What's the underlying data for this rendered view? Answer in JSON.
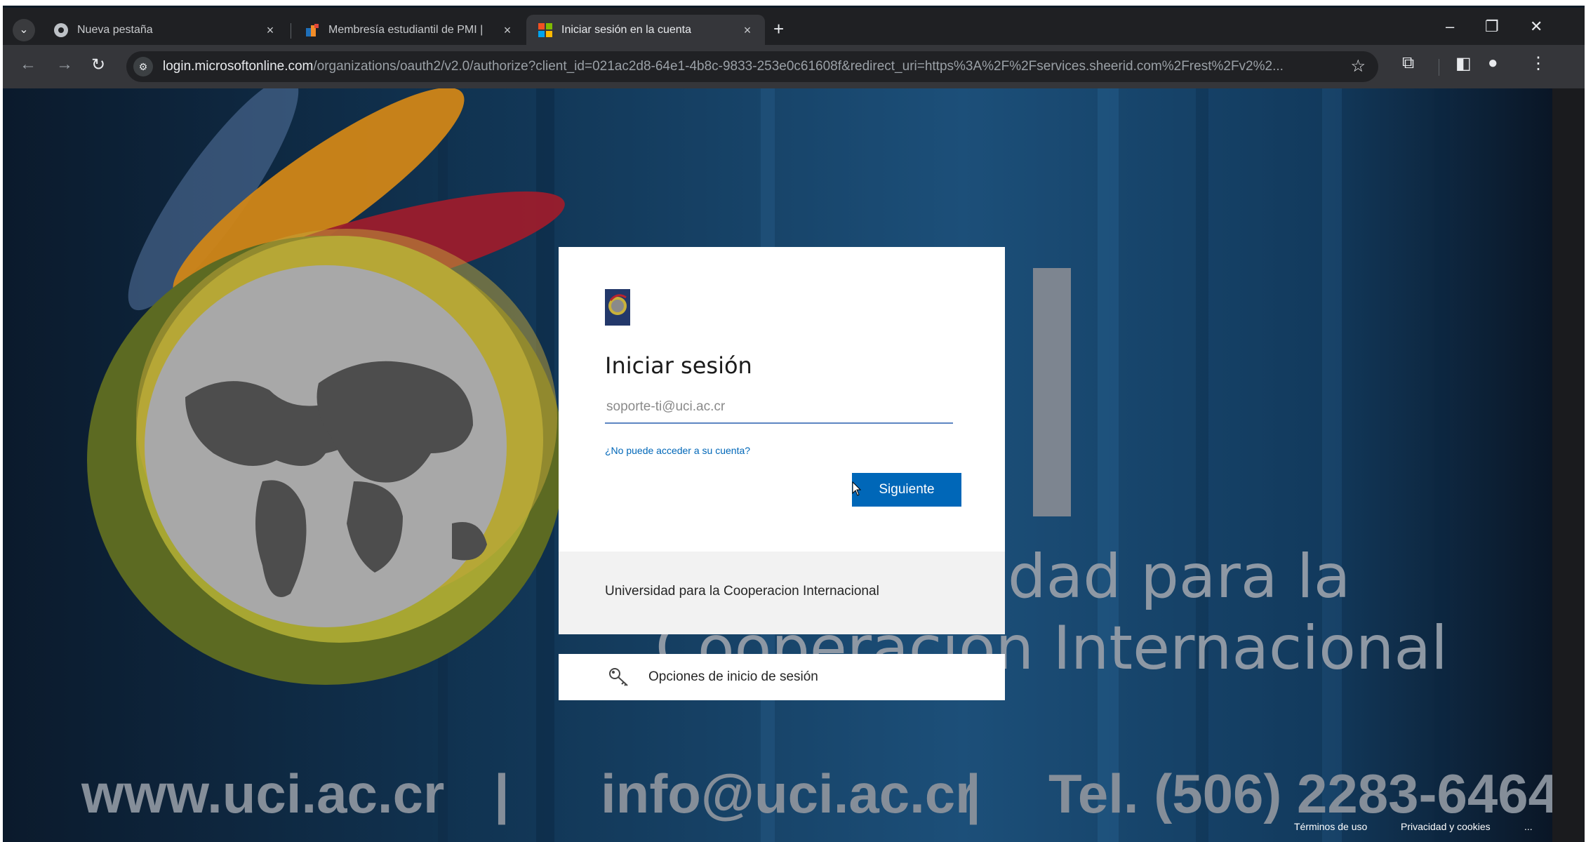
{
  "browser": {
    "tabs": [
      {
        "label": "Nueva pestaña",
        "active": false
      },
      {
        "label": "Membresía estudiantil de PMI |",
        "active": false
      },
      {
        "label": "Iniciar sesión en la cuenta",
        "active": true
      }
    ],
    "new_tab_symbol": "+",
    "url_host": "login.microsoftonline.com",
    "url_path": "/organizations/oauth2/v2.0/authorize?client_id=021ac2d8-64e1-4b8c-9833-253e0c61608f&redirect_uri=https%3A%2F%2Fservices.sheerid.com%2Frest%2Fv2%2..."
  },
  "background": {
    "headline_line1": "dad para la",
    "headline_line2": "Cooperación Internacional",
    "website": "www.uci.ac.cr",
    "separator": "|",
    "email": "info@uci.ac.cr",
    "phone": "Tel. (506) 2283-6464"
  },
  "login": {
    "title": "Iniciar sesión",
    "email_value": "soporte-ti@uci.ac.cr",
    "cant_access_link": "¿No puede acceder a su cuenta?",
    "next_button": "Siguiente",
    "organization": "Universidad para la Cooperacion Internacional",
    "signin_options": "Opciones de inicio de sesión"
  },
  "footer_links": {
    "terms": "Términos de uso",
    "privacy": "Privacidad y cookies",
    "more": "..."
  },
  "colors": {
    "accent_blue": "#0067b8",
    "page_background": "#113554"
  },
  "icons": {
    "tab_search": "chevron-down-icon",
    "nueva_tab": "chrome-icon",
    "pmi_tab": "pmi-logo-icon",
    "microsoft_tab": "microsoft-logo-icon",
    "signin_options": "key-icon"
  }
}
